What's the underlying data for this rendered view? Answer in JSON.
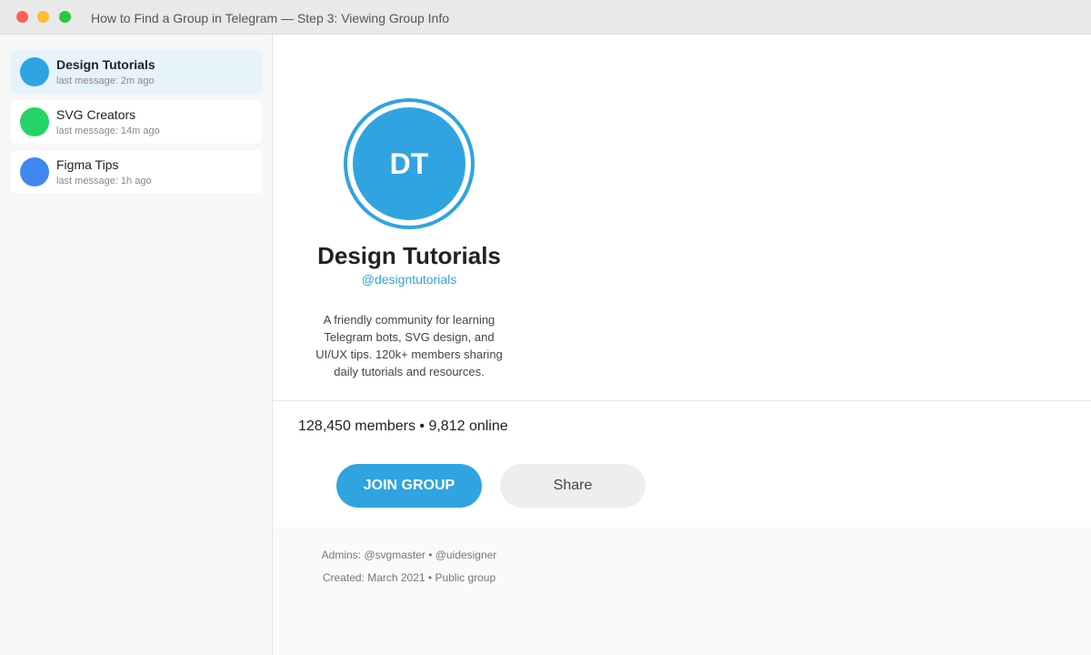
{
  "window": {
    "title": "How to Find a Group in Telegram — Step 3: Viewing Group Info",
    "lights": {
      "close": "#ff5f57",
      "minimize": "#febc2e",
      "zoom": "#28c840"
    }
  },
  "sidebar": {
    "items": [
      {
        "name": "Design Tutorials",
        "meta": "last message: 2m ago",
        "color": "#2fa4e1",
        "active": true
      },
      {
        "name": "SVG Creators",
        "meta": "last message: 14m ago",
        "color": "#25d366",
        "active": false
      },
      {
        "name": "Figma Tips",
        "meta": "last message: 1h ago",
        "color": "#3f88f0",
        "active": false
      }
    ]
  },
  "group": {
    "initials": "DT",
    "name": "Design Tutorials",
    "handle": "@designtutorials",
    "description": "A friendly community for learning Telegram bots, SVG design, and UI/UX tips. 120k+ members sharing daily tutorials and resources.",
    "stats": "128,450 members • 9,812 online",
    "accent": "#2fa4e1"
  },
  "actions": {
    "join_label": "JOIN GROUP",
    "share_label": "Share"
  },
  "footer": {
    "admins": "Admins: @svgmaster • @uidesigner",
    "created": "Created: March 2021 • Public group"
  }
}
